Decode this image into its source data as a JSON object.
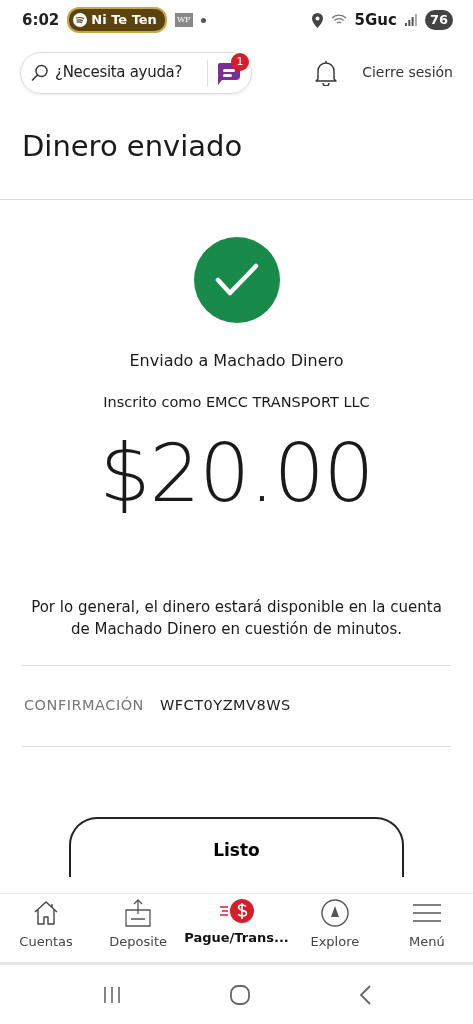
{
  "status_bar": {
    "time": "6:02",
    "media_pill": "Ni Te Ten",
    "app_badge": "WF",
    "network": "5Guc",
    "battery": "76"
  },
  "header": {
    "search": {
      "placeholder": "¿Necesita ayuda?"
    },
    "chat_badge": "1",
    "logout": "Cierre sesión"
  },
  "page_title": "Dinero enviado",
  "confirmation": {
    "recipient_line": "Enviado a Machado Dinero",
    "enrolled_line": "Inscrito como EMCC TRANSPORT LLC",
    "amount": "$20.00",
    "note": "Por lo general, el dinero estará disponible en la cuenta de Machado Dinero en cuestión de minutos.",
    "details": [
      {
        "label": "CONFIRMACIÓN",
        "value": "WFCT0YZMV8WS"
      }
    ],
    "done_button": "Listo"
  },
  "bottom_nav": [
    {
      "label": "Cuentas",
      "selected": false
    },
    {
      "label": "Deposite",
      "selected": false
    },
    {
      "label": "Pague/Trans...",
      "selected": true
    },
    {
      "label": "Explore",
      "selected": false
    },
    {
      "label": "Menú",
      "selected": false
    }
  ]
}
